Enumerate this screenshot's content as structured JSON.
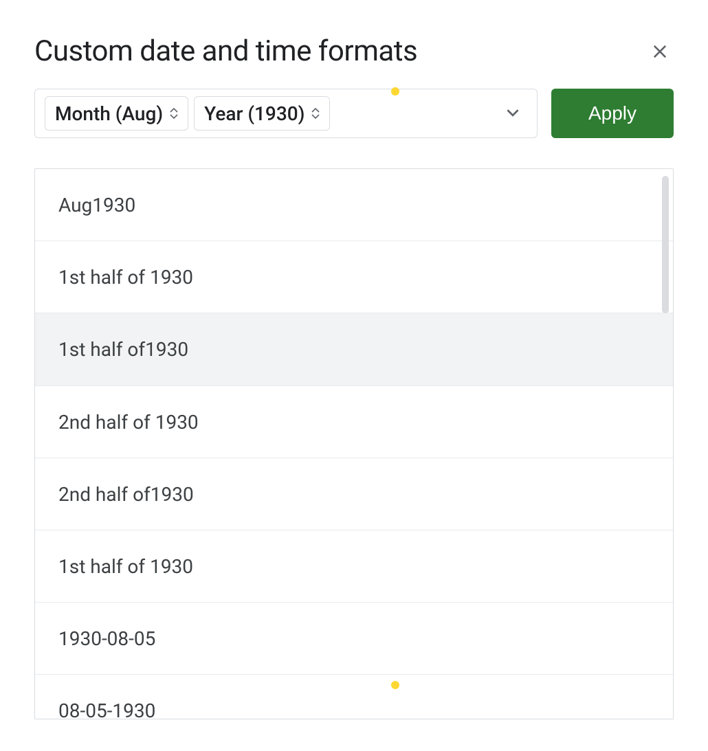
{
  "dialog": {
    "title": "Custom date and time formats",
    "apply_label": "Apply"
  },
  "chips": [
    {
      "label": "Month (Aug)"
    },
    {
      "label": "Year (1930)"
    }
  ],
  "format_list": [
    {
      "text": "Aug1930",
      "highlighted": false
    },
    {
      "text": "1st half of 1930",
      "highlighted": false
    },
    {
      "text": "1st half of1930",
      "highlighted": true
    },
    {
      "text": "2nd half of 1930",
      "highlighted": false
    },
    {
      "text": "2nd half of1930",
      "highlighted": false
    },
    {
      "text": "1st half of 1930",
      "highlighted": false
    },
    {
      "text": "1930-08-05",
      "highlighted": false
    },
    {
      "text": "08-05-1930",
      "highlighted": false
    }
  ]
}
